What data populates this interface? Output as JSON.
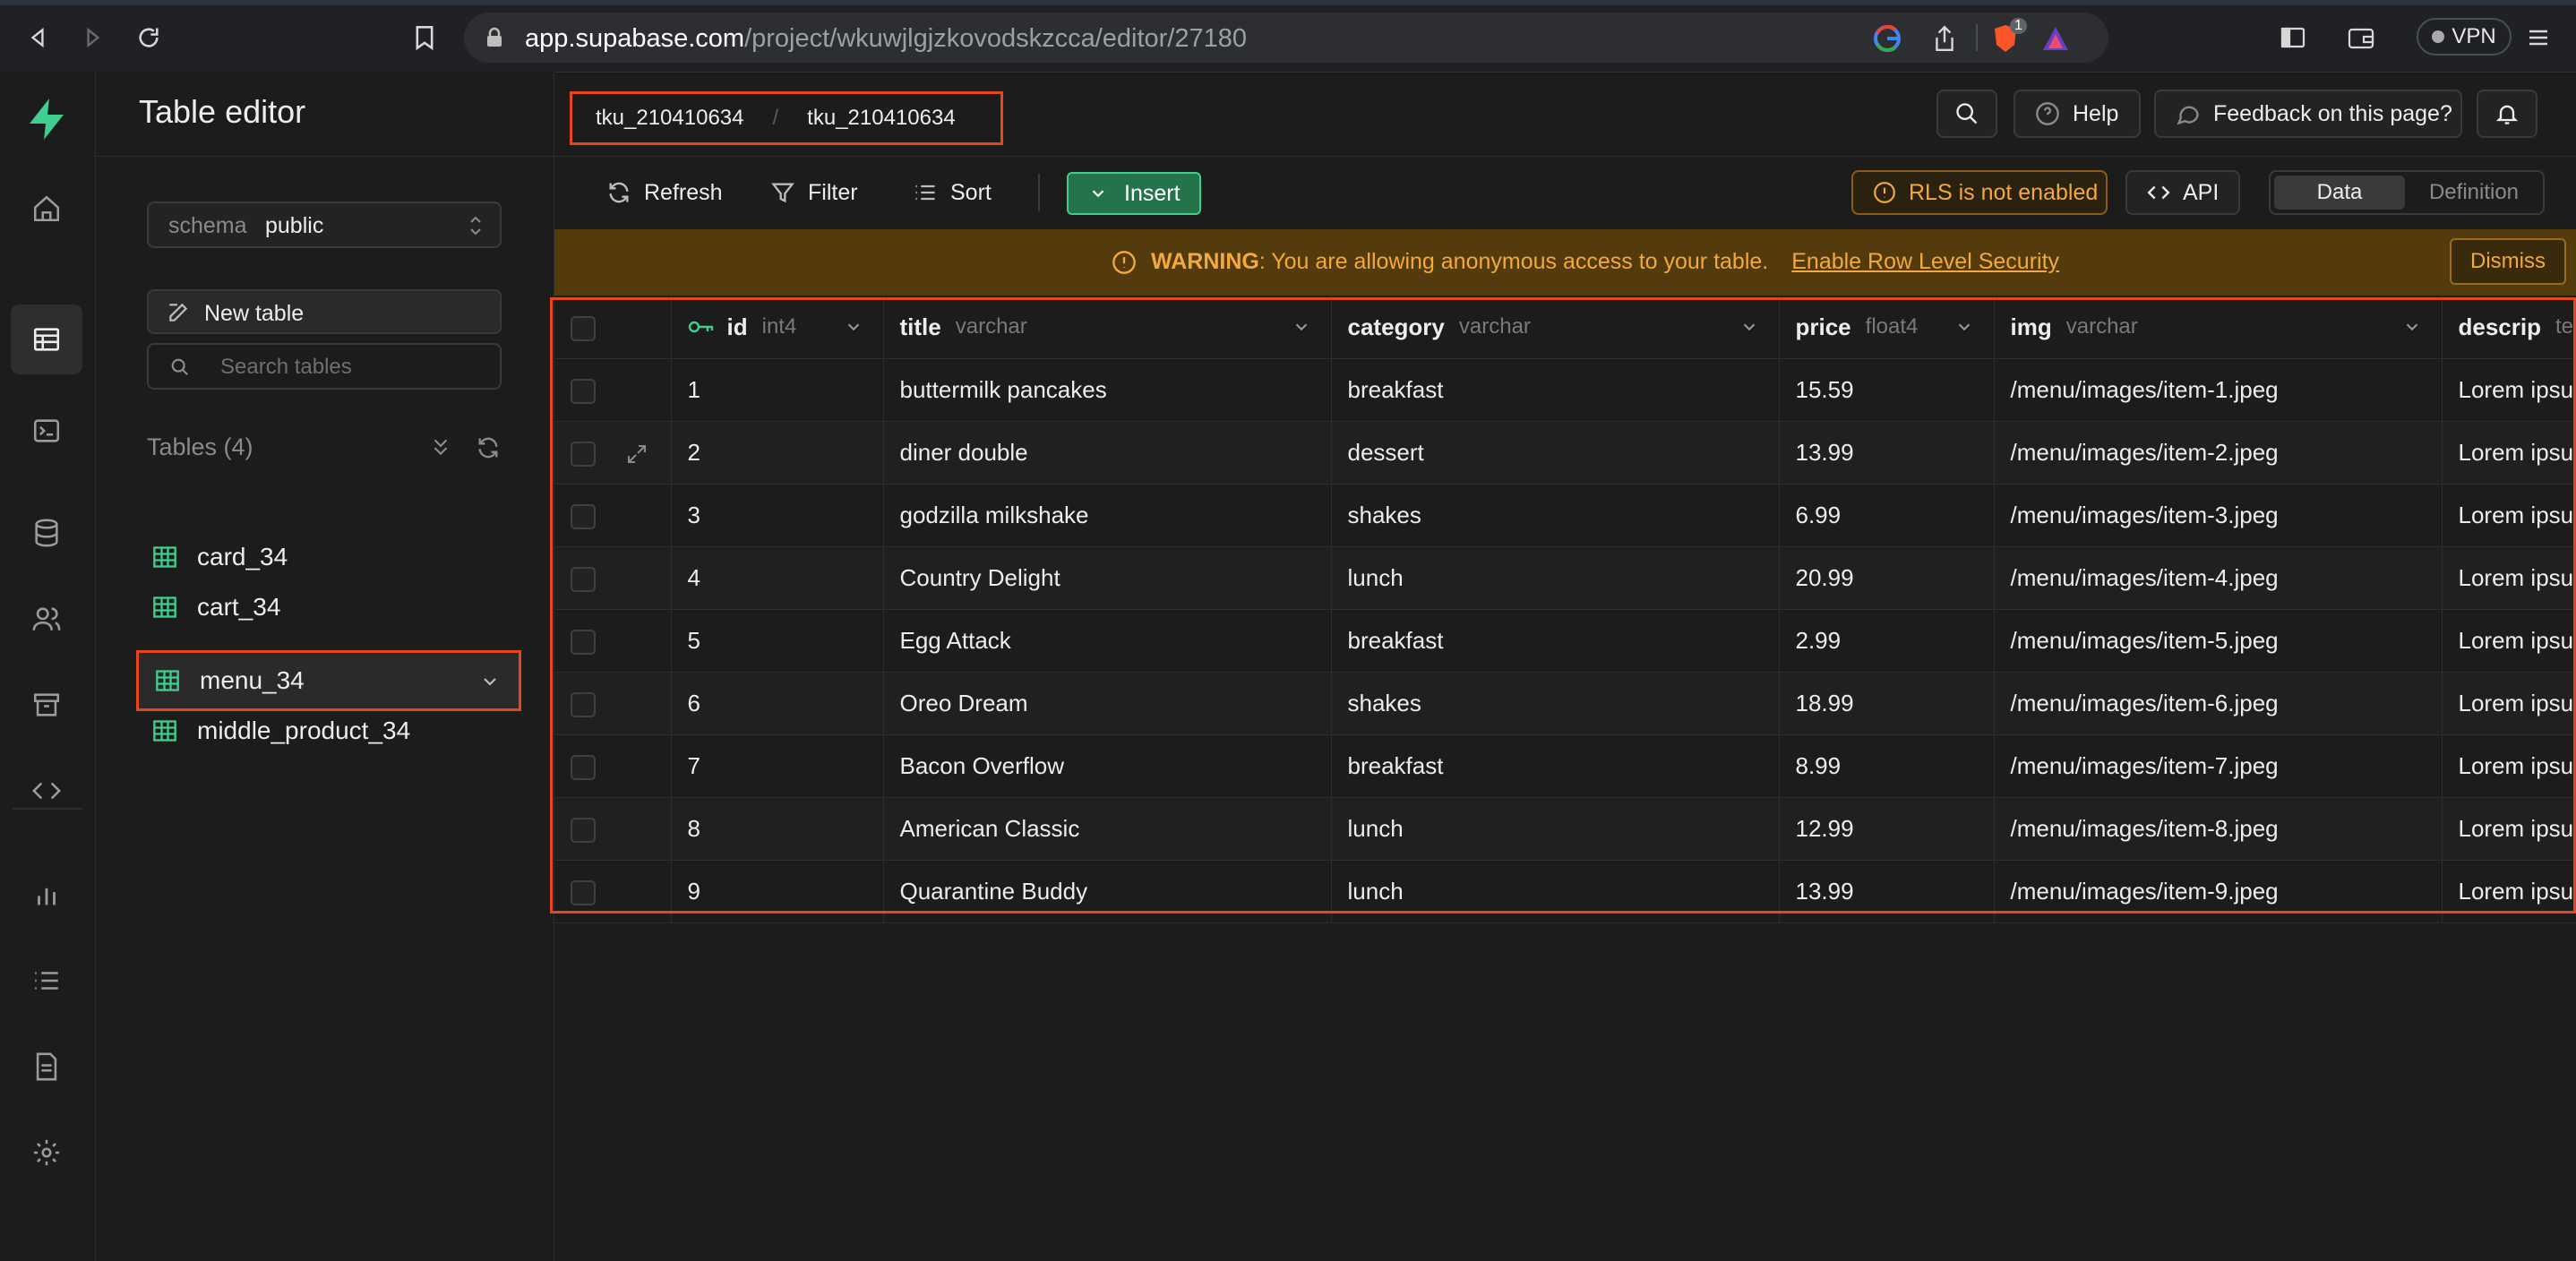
{
  "browser": {
    "url_host": "app.supabase.com",
    "url_path": "/project/wkuwjlgjzkovodskzcca/editor/27180",
    "vpn_label": "VPN",
    "shield_badge": "1"
  },
  "sidebar": {
    "title": "Table editor",
    "schema_label": "schema",
    "schema_value": "public",
    "new_table_label": "New table",
    "search_placeholder": "Search tables",
    "tables_header": "Tables (4)",
    "tables": [
      {
        "name": "card_34"
      },
      {
        "name": "cart_34"
      },
      {
        "name": "menu_34"
      },
      {
        "name": "middle_product_34"
      }
    ]
  },
  "header": {
    "breadcrumb": [
      "tku_210410634",
      "tku_210410634"
    ],
    "breadcrumb_sep": "/",
    "help_label": "Help",
    "feedback_label": "Feedback on this page?"
  },
  "toolbar": {
    "refresh_label": "Refresh",
    "filter_label": "Filter",
    "sort_label": "Sort",
    "insert_label": "Insert",
    "rls_label": "RLS is not enabled",
    "api_label": "API",
    "tab_data": "Data",
    "tab_definition": "Definition"
  },
  "warning": {
    "prefix": "WARNING",
    "message": ": You are allowing anonymous access to your table.",
    "link": "Enable Row Level Security",
    "dismiss_label": "Dismiss"
  },
  "grid": {
    "columns": [
      {
        "name": "id",
        "type": "int4"
      },
      {
        "name": "title",
        "type": "varchar"
      },
      {
        "name": "category",
        "type": "varchar"
      },
      {
        "name": "price",
        "type": "float4"
      },
      {
        "name": "img",
        "type": "varchar"
      },
      {
        "name": "descrip",
        "type": "tex"
      }
    ],
    "rows": [
      {
        "id": "1",
        "title": "buttermilk pancakes",
        "category": "breakfast",
        "price": "15.59",
        "img": "/menu/images/item-1.jpeg",
        "descrip": "Lorem ipsu"
      },
      {
        "id": "2",
        "title": "diner double",
        "category": "dessert",
        "price": "13.99",
        "img": "/menu/images/item-2.jpeg",
        "descrip": "Lorem ipsu"
      },
      {
        "id": "3",
        "title": "godzilla milkshake",
        "category": "shakes",
        "price": "6.99",
        "img": "/menu/images/item-3.jpeg",
        "descrip": "Lorem ipsu"
      },
      {
        "id": "4",
        "title": "Country Delight",
        "category": "lunch",
        "price": "20.99",
        "img": "/menu/images/item-4.jpeg",
        "descrip": "Lorem ipsu"
      },
      {
        "id": "5",
        "title": "Egg Attack",
        "category": "breakfast",
        "price": "2.99",
        "img": "/menu/images/item-5.jpeg",
        "descrip": "Lorem ipsu"
      },
      {
        "id": "6",
        "title": "Oreo Dream",
        "category": "shakes",
        "price": "18.99",
        "img": "/menu/images/item-6.jpeg",
        "descrip": "Lorem ipsu"
      },
      {
        "id": "7",
        "title": "Bacon Overflow",
        "category": "breakfast",
        "price": "8.99",
        "img": "/menu/images/item-7.jpeg",
        "descrip": "Lorem ipsu"
      },
      {
        "id": "8",
        "title": "American Classic",
        "category": "lunch",
        "price": "12.99",
        "img": "/menu/images/item-8.jpeg",
        "descrip": "Lorem ipsu"
      },
      {
        "id": "9",
        "title": "Quarantine Buddy",
        "category": "lunch",
        "price": "13.99",
        "img": "/menu/images/item-9.jpeg",
        "descrip": "Lorem ipsu"
      }
    ]
  },
  "colors": {
    "accent_green": "#3ecf8e",
    "highlight_red": "#e5461a",
    "warning_amber": "#f3a93b"
  },
  "icons": {
    "rail": [
      "home-icon",
      "table-editor-icon",
      "sql-editor-icon",
      "database-icon",
      "auth-icon",
      "storage-icon",
      "api-docs-icon",
      "reports-icon",
      "logs-icon",
      "docs-icon",
      "settings-icon"
    ]
  }
}
